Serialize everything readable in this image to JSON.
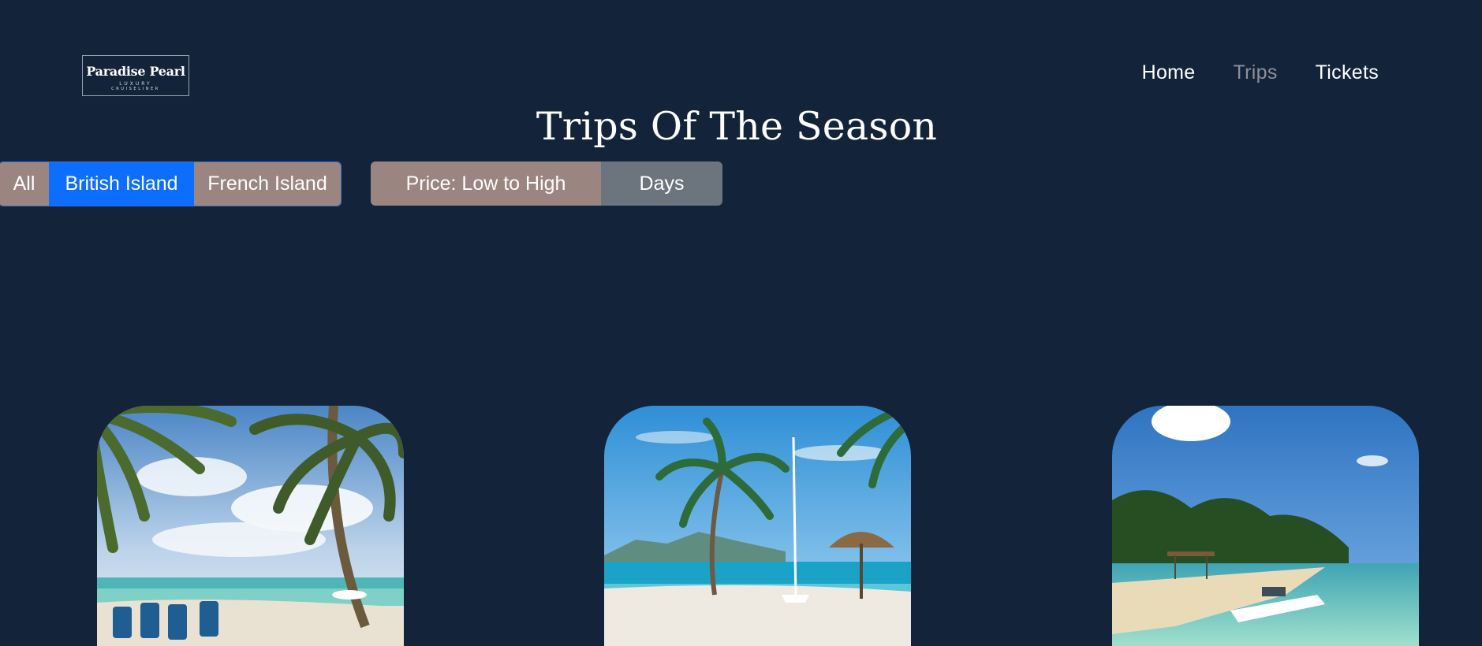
{
  "brand": {
    "name": "Paradise Pearl",
    "tagline_1": "LUXURY",
    "tagline_2": "CRUISELINER"
  },
  "nav": {
    "items": [
      {
        "label": "Home",
        "active": false
      },
      {
        "label": "Trips",
        "active": true
      },
      {
        "label": "Tickets",
        "active": false
      }
    ]
  },
  "main": {
    "title": "Trips Of The Season",
    "filters": {
      "all": "All",
      "british": "British Island",
      "french": "French Island",
      "selected": "British Island"
    },
    "sort": {
      "price": "Price: Low to High",
      "days": "Days"
    }
  },
  "trips": [
    {
      "image": "palm-beach-chairs-image"
    },
    {
      "image": "palm-beach-umbrella-image"
    },
    {
      "image": "tropical-beach-boat-image"
    }
  ],
  "colors": {
    "background": "#13243a",
    "accent": "#0d6efd",
    "filter_inactive": "#9b8580",
    "secondary": "#6c757d",
    "nav_active": "#8f8f97"
  }
}
